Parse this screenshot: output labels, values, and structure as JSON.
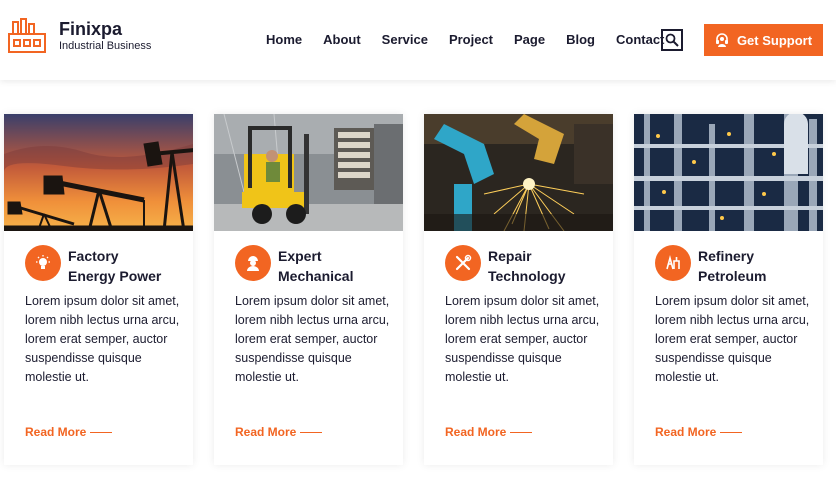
{
  "brand": {
    "title": "Finixpa",
    "subtitle": "Industrial Business"
  },
  "nav": [
    {
      "label": "Home"
    },
    {
      "label": "About"
    },
    {
      "label": "Service"
    },
    {
      "label": "Project"
    },
    {
      "label": "Page"
    },
    {
      "label": "Blog"
    },
    {
      "label": "Contact"
    }
  ],
  "support_button": {
    "label": "Get Support",
    "icon": "headset-icon"
  },
  "search": {
    "icon": "search-icon"
  },
  "colors": {
    "accent": "#f26522",
    "text": "#1b1b2f"
  },
  "cards": [
    {
      "title_line1": "Factory",
      "title_line2": "Energy Power",
      "icon": "lightbulb-icon",
      "image": "oil-pumpjack-sunset",
      "body": "Lorem ipsum dolor sit amet, lorem nibh lectus urna arcu, lorem erat semper, auctor suspendisse quisque molestie ut.",
      "link": "Read More"
    },
    {
      "title_line1": "Expert",
      "title_line2": "Mechanical",
      "icon": "worker-icon",
      "image": "forklift-warehouse",
      "body": "Lorem ipsum dolor sit amet, lorem nibh lectus urna arcu, lorem erat semper, auctor suspendisse quisque molestie ut.",
      "link": "Read More"
    },
    {
      "title_line1": "Repair",
      "title_line2": "Technology",
      "icon": "tools-icon",
      "image": "robot-welding-sparks",
      "body": "Lorem ipsum dolor sit amet, lorem nibh lectus urna arcu, lorem erat semper, auctor suspendisse quisque molestie ut.",
      "link": "Read More"
    },
    {
      "title_line1": "Refinery",
      "title_line2": "Petroleum",
      "icon": "refinery-icon",
      "image": "refinery-pipes-night",
      "body": "Lorem ipsum dolor sit amet, lorem nibh lectus urna arcu, lorem erat semper, auctor suspendisse quisque molestie ut.",
      "link": "Read More"
    }
  ]
}
